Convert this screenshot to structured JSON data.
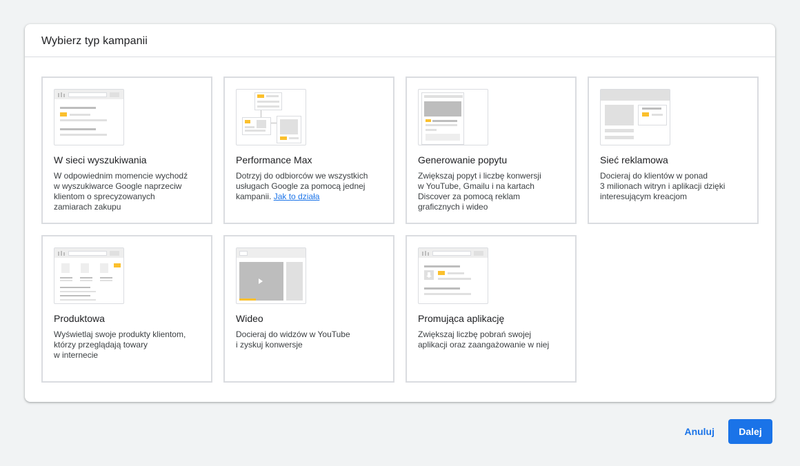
{
  "dialog": {
    "title": "Wybierz typ kampanii"
  },
  "campaigns": [
    {
      "title": "W sieci wyszukiwania",
      "description": "W odpowiednim momencie wychodź\nw wyszukiwarce Google naprzeciw\nklientom o sprecyzowanych\nzamiarach zakupu"
    },
    {
      "title": "Performance Max",
      "description": "Dotrzyj do odbiorców we wszystkich\nusługach Google za pomocą jednej\nkampanii. ",
      "link": "Jak to działa"
    },
    {
      "title": "Generowanie popytu",
      "description": "Zwiększaj popyt i liczbę konwersji\nw YouTube, Gmailu i na kartach\nDiscover za pomocą reklam\ngraficznych i wideo"
    },
    {
      "title": "Sieć reklamowa",
      "description": "Docieraj do klientów w ponad\n3 milionach witryn i aplikacji dzięki\ninteresującym kreacjom"
    },
    {
      "title": "Produktowa",
      "description": "Wyświetlaj swoje produkty klientom,\nktórzy przeglądają towary\nw internecie"
    },
    {
      "title": "Wideo",
      "description": "Docieraj do widzów w YouTube\ni zyskuj konwersje"
    },
    {
      "title": "Promująca aplikację",
      "description": "Zwiększaj liczbę pobrań swojej\naplikacji oraz zaangażowanie w niej"
    }
  ],
  "footer": {
    "cancel_label": "Anuluj",
    "next_label": "Dalej"
  },
  "colors": {
    "accent": "#1a73e8",
    "illustration_highlight": "#fbc02d",
    "border": "#dadce0"
  }
}
